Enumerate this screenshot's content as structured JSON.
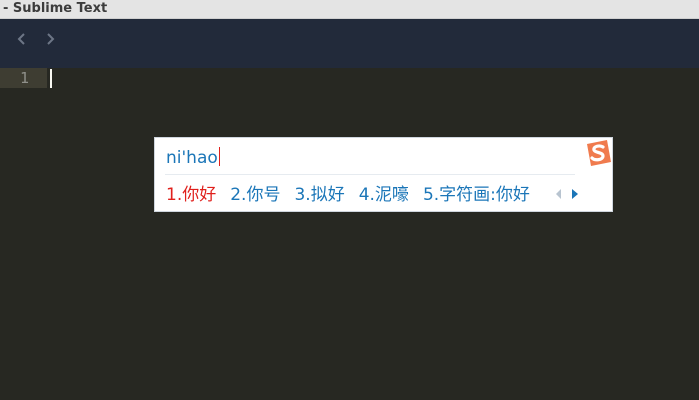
{
  "window": {
    "title": "- Sublime Text"
  },
  "tabbar": {
    "back_icon": "chevron-left-icon",
    "forward_icon": "chevron-right-icon"
  },
  "editor": {
    "line_numbers": [
      "1"
    ],
    "colors": {
      "background": "#272822",
      "tabbar": "#222a3a"
    }
  },
  "ime": {
    "input_text": "ni'hao",
    "logo_icon": "sogou-s-logo-icon",
    "candidates": [
      {
        "label": "1.你好"
      },
      {
        "label": "2.你号"
      },
      {
        "label": "3.拟好"
      },
      {
        "label": "4.泥嚎"
      },
      {
        "label": "5.字符画:你好"
      }
    ],
    "prev_icon": "triangle-left-icon",
    "next_icon": "triangle-right-icon",
    "colors": {
      "text": "#1b76b8",
      "selected": "#e0201c",
      "logo": "#f07b4e"
    }
  }
}
